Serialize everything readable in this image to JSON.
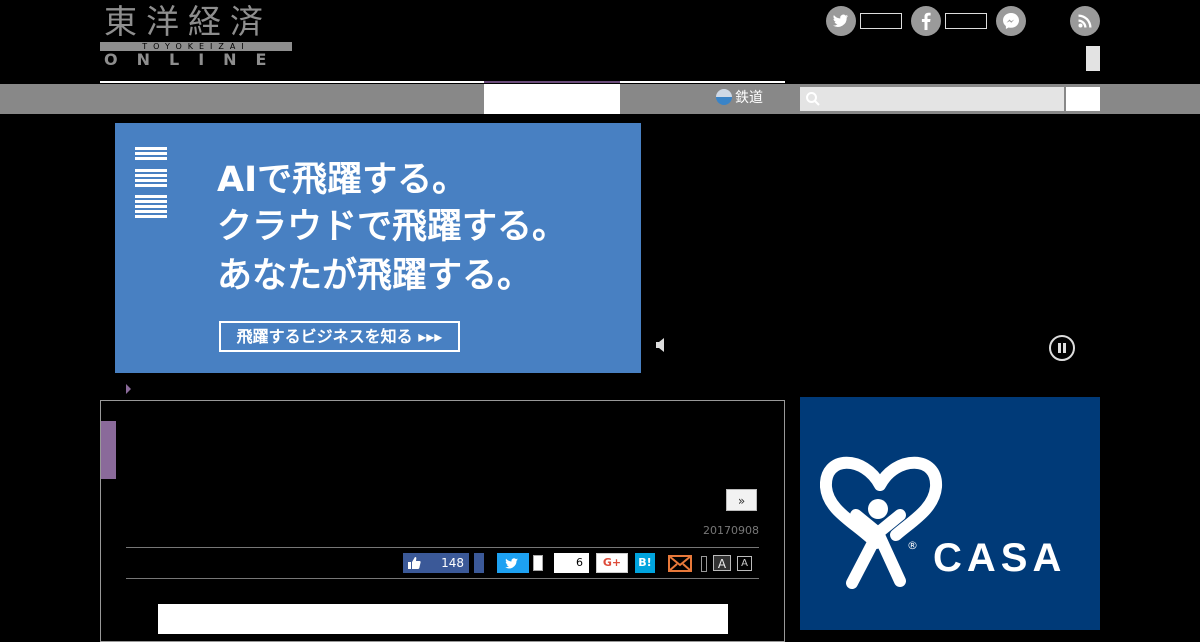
{
  "logo": {
    "title": "東洋経済",
    "subtitle": "TOYOKEIZAI",
    "online": "ONLINE"
  },
  "header": {
    "social": [
      "twitter-icon",
      "facebook-icon",
      "messenger-icon",
      "rss-icon"
    ]
  },
  "nav": {
    "rail_label": "鉄道",
    "search": {
      "placeholder": ""
    }
  },
  "ad": {
    "brand": "IBM",
    "lines": [
      "AIで飛躍する。",
      "クラウドで飛躍する。",
      "あなたが飛躍する。"
    ],
    "cta": "飛躍するビジネスを知る ▸▸▸",
    "bg_color": "#4880c2"
  },
  "article": {
    "next_label": "»",
    "date": "20170908",
    "share": {
      "facebook_count": "148",
      "google_count": "6",
      "google_label": "G+",
      "hatena_label": "B!"
    },
    "font_sizes": [
      "A",
      "A"
    ]
  },
  "side_ad": {
    "brand": "CASA",
    "registered_mark": "®",
    "bg_color": "#003a78"
  },
  "colors": {
    "accent": "#8a6a9a",
    "nav": "#888888",
    "twitter": "#1da1f2",
    "facebook": "#3b5998"
  }
}
